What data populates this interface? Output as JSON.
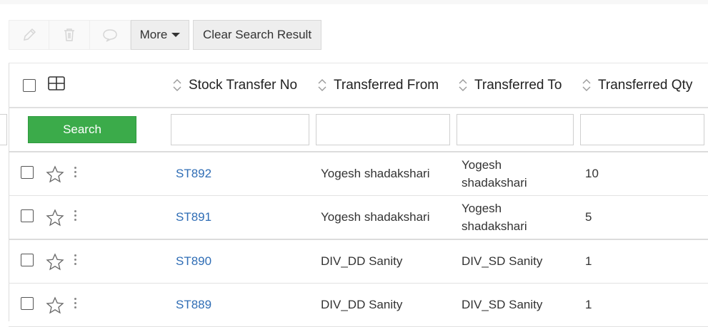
{
  "toolbar": {
    "edit_icon": "pencil-icon",
    "delete_icon": "trash-icon",
    "comment_icon": "comment-icon",
    "more_label": "More",
    "clear_label": "Clear Search Result"
  },
  "table": {
    "columns": [
      {
        "key": "no",
        "label": "Stock Transfer No"
      },
      {
        "key": "from",
        "label": "Transferred From"
      },
      {
        "key": "to",
        "label": "Transferred To"
      },
      {
        "key": "qty",
        "label": "Transferred Qty"
      }
    ],
    "search_label": "Search",
    "rows": [
      {
        "no": "ST892",
        "from": "Yogesh shadakshari",
        "to_line1": "Yogesh",
        "to_line2": "shadakshari",
        "qty": "10"
      },
      {
        "no": "ST891",
        "from": "Yogesh shadakshari",
        "to_line1": "Yogesh",
        "to_line2": "shadakshari",
        "qty": "5"
      },
      {
        "no": "ST890",
        "from": "DIV_DD Sanity",
        "to_line1": "DIV_SD Sanity",
        "to_line2": "",
        "qty": "1"
      },
      {
        "no": "ST889",
        "from": "DIV_DD Sanity",
        "to_line1": "DIV_SD Sanity",
        "to_line2": "",
        "qty": "1"
      }
    ]
  },
  "colors": {
    "search_button": "#3bab4a",
    "link": "#2f6db5"
  }
}
